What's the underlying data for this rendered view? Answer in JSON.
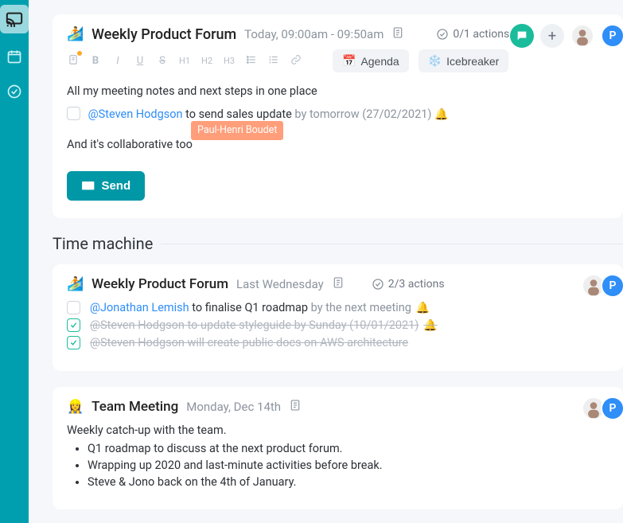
{
  "sidebar": {
    "cast": "cast",
    "calendar": "calendar",
    "check": "check"
  },
  "meeting": {
    "emoji": "🏄",
    "title": "Weekly Product Forum",
    "time": "Today, 09:00am - 09:50am",
    "actions": "0/1 actions",
    "toolbar": {
      "b": "B",
      "i": "I",
      "u": "U",
      "s": "S",
      "h1": "H1",
      "h2": "H2",
      "h3": "H3"
    },
    "agenda_label": "Agenda",
    "icebreaker_label": "Icebreaker",
    "notes_intro": "All my meeting notes and next steps in one place",
    "task_mention": "@Steven Hodgson",
    "task_text": " to send sales update ",
    "task_due": "by tomorrow (27/02/2021) ",
    "collab_text": "And it's collaborative too",
    "collab_tag": "Paul-Henri Boudet",
    "send_label": "Send",
    "avatar_p": "P"
  },
  "timemachine_title": "Time machine",
  "past1": {
    "emoji": "🏄",
    "title": "Weekly Product Forum",
    "subtitle": "Last Wednesday",
    "actions": "2/3 actions",
    "avatar_p": "P",
    "tasks": [
      {
        "mention": "@Jonathan Lemish",
        "text": " to finalise Q1 roadmap ",
        "due": "by the next meeting ",
        "done": false,
        "bell": "🔔"
      },
      {
        "mention": "@Steven Hodgson",
        "text": " to update styleguide ",
        "due": "by Sunday (10/01/2021) ",
        "done": true,
        "bell": "🔔"
      },
      {
        "mention": "@Steven Hodgson",
        "text": " will create public docs on AWS architecture",
        "due": "",
        "done": true,
        "bell": ""
      }
    ]
  },
  "past2": {
    "emoji": "👷‍♀️",
    "title": "Team Meeting",
    "subtitle": "Monday, Dec 14th",
    "avatar_p": "P",
    "desc": "Weekly catch-up with the team.",
    "bullets": [
      "Q1 roadmap to discuss at the next product forum.",
      "Wrapping up 2020 and last-minute activities before break.",
      "Steve & Jono back on the 4th of January."
    ]
  }
}
